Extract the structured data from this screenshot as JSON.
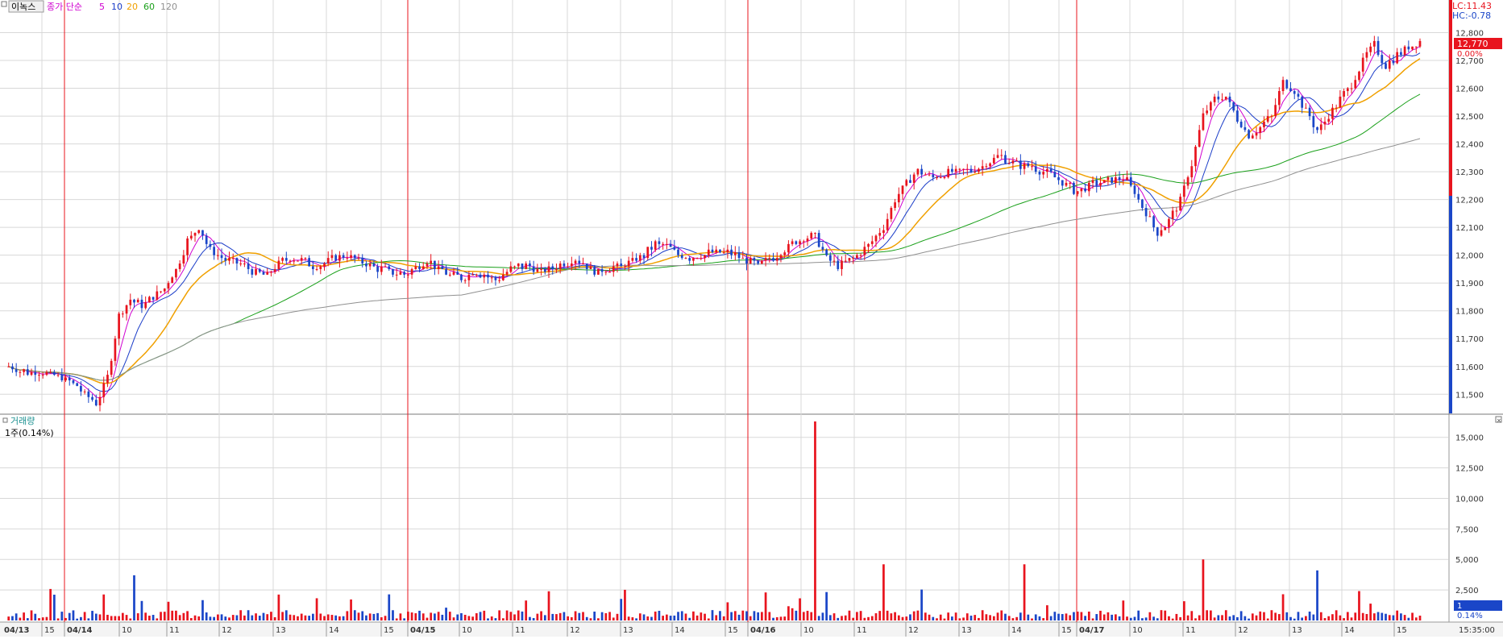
{
  "header": {
    "stock_name": "이녹스",
    "legend_prefix": "종가 단순",
    "ma_periods": [
      "5",
      "10",
      "20",
      "60",
      "120"
    ],
    "ma_colors": [
      "#d000d0",
      "#1a3cc8",
      "#f0a000",
      "#1aa01a",
      "#909090"
    ],
    "lc_label": "LC:11.43",
    "hc_label": "HC:-0.78"
  },
  "price_panel": {
    "last_price_badge": "12,770",
    "change_badge": "0.00%",
    "y_ticks": [
      "12,800",
      "12,700",
      "12,600",
      "12,500",
      "12,400",
      "12,300",
      "12,200",
      "12,100",
      "12,000",
      "11,900",
      "11,800",
      "11,700",
      "11,600",
      "11,500"
    ]
  },
  "volume_panel": {
    "title": "거래량",
    "subtitle": "1주(0.14%)",
    "y_ticks": [
      "15,000",
      "12,500",
      "10,000",
      "7,500",
      "5,000",
      "2,500"
    ],
    "volume_badge": "1",
    "volume_pct_badge": "0.14%"
  },
  "x_axis": {
    "labels": [
      "04/13",
      "15",
      "04/14",
      "10",
      "11",
      "12",
      "13",
      "14",
      "15",
      "04/15",
      "10",
      "11",
      "12",
      "13",
      "14",
      "15",
      "04/16",
      "10",
      "11",
      "12",
      "13",
      "14",
      "15",
      "04/17",
      "10",
      "11",
      "12",
      "13",
      "14",
      "15"
    ],
    "time_label": "15:35:00"
  },
  "colors": {
    "up": "#e8141e",
    "down": "#1a46c8",
    "grid": "#d8d8d8",
    "day_separator": "#e8141e",
    "axis_bg": "#f4f4f4"
  },
  "chart_data": {
    "type": "candlestick_with_volume",
    "title": "이녹스",
    "ylim": [
      11440,
      12900
    ],
    "volume_ylim": [
      0,
      16500
    ],
    "days": [
      "04/13",
      "04/14",
      "04/15",
      "04/16",
      "04/17"
    ],
    "day_session_closes": [
      {
        "day": "04/13",
        "close": 11550
      },
      {
        "day": "04/14",
        "close": 11920
      },
      {
        "day": "04/15",
        "close": 12000
      },
      {
        "day": "04/16",
        "close": 12250
      },
      {
        "day": "04/17",
        "close": 12770
      }
    ],
    "price_series": [
      11600,
      11590,
      11580,
      11580,
      11570,
      11560,
      11540,
      11500,
      11470,
      11560,
      11780,
      11840,
      11820,
      11850,
      11880,
      11950,
      12050,
      12100,
      12020,
      11990,
      11980,
      11960,
      11940,
      11930,
      11970,
      11990,
      11980,
      11960,
      11970,
      11990,
      12000,
      11980,
      11960,
      11950,
      11940,
      11930,
      11960,
      11980,
      11950,
      11930,
      11920,
      11940,
      11930,
      11910,
      11940,
      11960,
      11960,
      11940,
      11950,
      11970,
      11990,
      11960,
      11940,
      11950,
      11960,
      11980,
      12000,
      12040,
      12030,
      12000,
      11990,
      12000,
      12010,
      12010,
      12000,
      11980,
      11960,
      11990,
      12010,
      12040,
      12060,
      12070,
      11990,
      11960,
      11980,
      12010,
      12050,
      12100,
      12200,
      12260,
      12300,
      12280,
      12290,
      12300,
      12300,
      12310,
      12330,
      12360,
      12340,
      12320,
      12320,
      12300,
      12280,
      12250,
      12230,
      12250,
      12260,
      12270,
      12280,
      12230,
      12150,
      12080,
      12120,
      12200,
      12330,
      12500,
      12560,
      12570,
      12490,
      12430,
      12460,
      12500,
      12620,
      12590,
      12520,
      12450,
      12500,
      12560,
      12610,
      12700,
      12760,
      12680,
      12720,
      12750,
      12770
    ],
    "moving_averages": [
      {
        "name": "5",
        "last": 12760
      },
      {
        "name": "10",
        "last": 12750
      },
      {
        "name": "20",
        "last": 12730
      },
      {
        "name": "60",
        "last": 12630
      },
      {
        "name": "120",
        "last": 12460
      }
    ],
    "volume_spikes": [
      {
        "day": "04/14",
        "value": 3700
      },
      {
        "day": "04/16",
        "value": 16300
      },
      {
        "day": "04/16",
        "value": 4600
      },
      {
        "day": "04/17",
        "value": 4600
      },
      {
        "day": "04/17",
        "value": 5000
      },
      {
        "day": "04/17",
        "value": 4100
      }
    ]
  }
}
